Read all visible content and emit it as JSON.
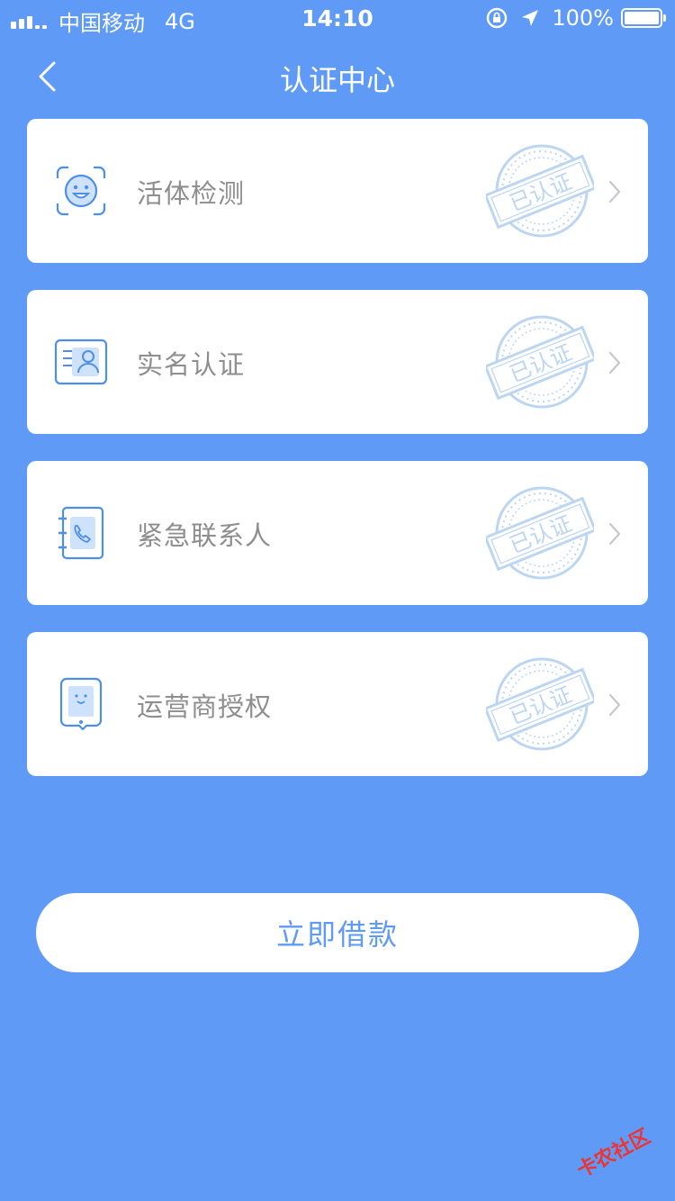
{
  "status": {
    "carrier": "中国移动",
    "network": "4G",
    "time": "14:10",
    "battery": "100%",
    "battery_level": 1.0
  },
  "nav": {
    "title": "认证中心"
  },
  "items": [
    {
      "label": "活体检测",
      "icon": "face-scan-icon",
      "stamp": "已认证"
    },
    {
      "label": "实名认证",
      "icon": "id-card-icon",
      "stamp": "已认证"
    },
    {
      "label": "紧急联系人",
      "icon": "contact-book-icon",
      "stamp": "已认证"
    },
    {
      "label": "运营商授权",
      "icon": "mobile-phone-icon",
      "stamp": "已认证"
    }
  ],
  "button": {
    "label": "立即借款"
  },
  "watermark": {
    "text": "卡农社区"
  },
  "colors": {
    "background": "#5f9bf6",
    "card": "#ffffff",
    "icon_blue": "#4d8fe8",
    "stamp_blue": "#bcd6f1",
    "label_gray": "#8e8e8e"
  }
}
